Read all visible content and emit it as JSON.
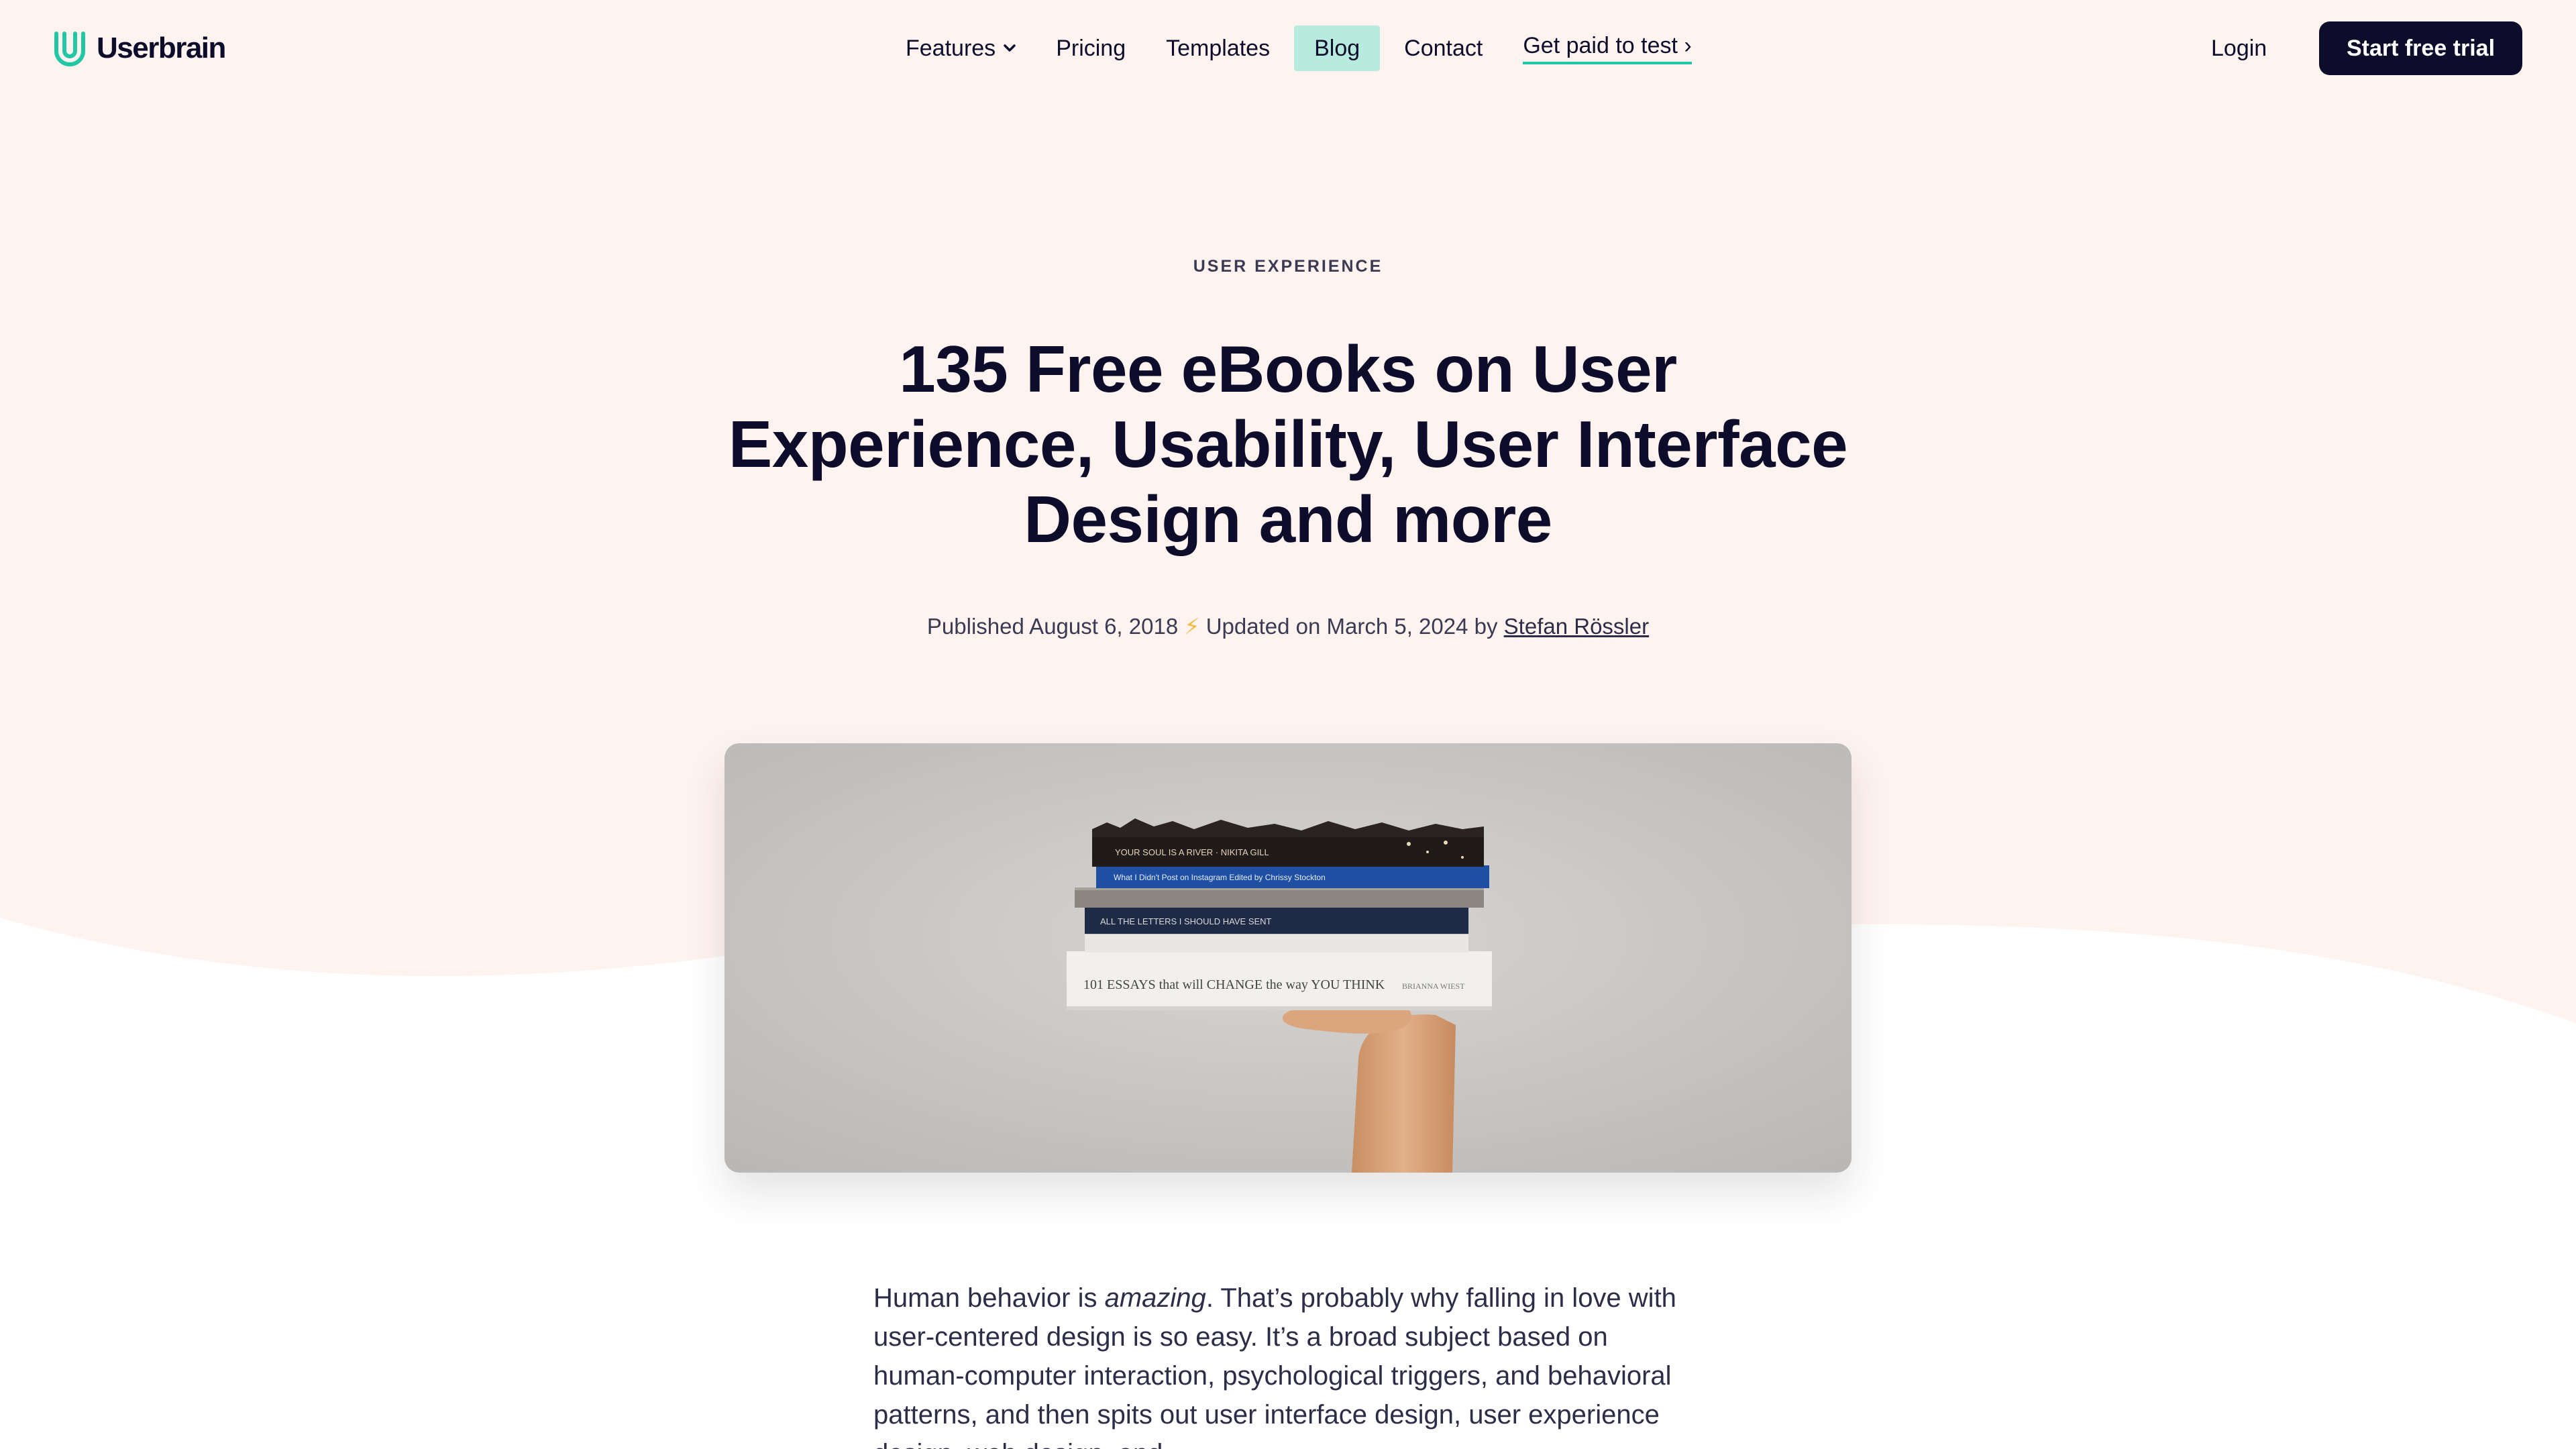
{
  "brand": {
    "name": "Userbrain",
    "accent": "#22c7a6",
    "dark": "#0d0d2b",
    "hero_bg": "#fff3f0"
  },
  "nav": {
    "items": [
      {
        "label": "Features",
        "has_dropdown": true
      },
      {
        "label": "Pricing"
      },
      {
        "label": "Templates"
      },
      {
        "label": "Blog",
        "active": true
      },
      {
        "label": "Contact"
      },
      {
        "label": "Get paid to test ›"
      }
    ],
    "login": "Login",
    "cta": "Start free trial"
  },
  "post": {
    "category": "USER EXPERIENCE",
    "title": "135 Free eBooks on User Experience, Usability, User Interface Design and more",
    "published": "Published August 6, 2018",
    "bolt": "⚡",
    "updated": "Updated on March 5, 2024 by",
    "author": "Stefan Rössler",
    "book_spines": [
      "YOUR SOUL IS A RIVER · NIKITA GILL",
      "What I Didn't Post on Instagram    Edited by Chrissy Stockton",
      "ALL THE LETTERS I SHOULD HAVE SENT",
      "101 ESSAYS that will CHANGE the way YOU THINK",
      "BRIANNA WIEST"
    ],
    "intro_before": "Human behavior is ",
    "intro_em": "amazing",
    "intro_after": ". That’s probably why falling in love with user-centered design is so easy. It’s a broad subject based on human-computer interaction, psychological triggers, and behavioral patterns, and then spits out user interface design, user experience design, web design, and"
  }
}
